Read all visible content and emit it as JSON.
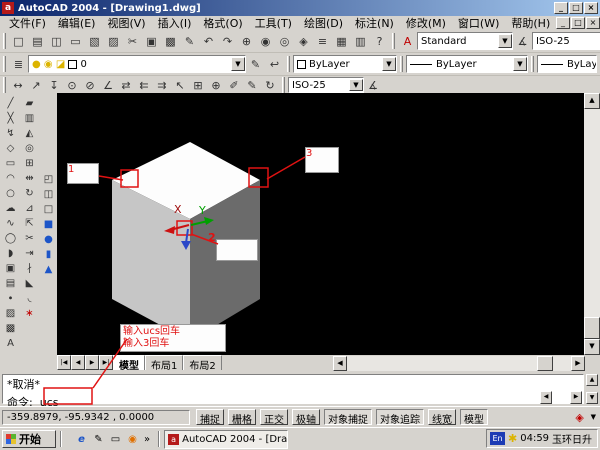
{
  "icons": {
    "dropdown": "▼"
  },
  "window": {
    "title": "AutoCAD 2004 - [Drawing1.dwg]",
    "app_icon_letter": "a",
    "controls": {
      "minimize": "_",
      "restore": "□",
      "close": "×"
    }
  },
  "menubar": {
    "items": [
      {
        "name": "menu-file",
        "label": "文件(F)"
      },
      {
        "name": "menu-edit",
        "label": "编辑(E)"
      },
      {
        "name": "menu-view",
        "label": "视图(V)"
      },
      {
        "name": "menu-insert",
        "label": "插入(I)"
      },
      {
        "name": "menu-format",
        "label": "格式(O)"
      },
      {
        "name": "menu-tools",
        "label": "工具(T)"
      },
      {
        "name": "menu-draw",
        "label": "绘图(D)"
      },
      {
        "name": "menu-dimension",
        "label": "标注(N)"
      },
      {
        "name": "menu-modify",
        "label": "修改(M)"
      },
      {
        "name": "menu-window",
        "label": "窗口(W)"
      },
      {
        "name": "menu-help",
        "label": "帮助(H)"
      }
    ]
  },
  "toolbars": {
    "standard": {
      "items": [
        {
          "name": "new-button",
          "glyph": "□"
        },
        {
          "name": "open-button",
          "glyph": "▤"
        },
        {
          "name": "save-button",
          "glyph": "◫"
        },
        {
          "name": "plot-button",
          "glyph": "▭"
        },
        {
          "name": "plot-preview-button",
          "glyph": "▧"
        },
        {
          "name": "publish-button",
          "glyph": "▨"
        },
        {
          "name": "cut-button",
          "glyph": "✂"
        },
        {
          "name": "copy-button",
          "glyph": "▣"
        },
        {
          "name": "paste-button",
          "glyph": "▩"
        },
        {
          "name": "match-properties-button",
          "glyph": "✎"
        },
        {
          "name": "undo-button",
          "glyph": "↶"
        },
        {
          "name": "redo-button",
          "glyph": "↷"
        },
        {
          "name": "pan-button",
          "glyph": "⊕"
        },
        {
          "name": "zoom-realtime-button",
          "glyph": "◉"
        },
        {
          "name": "zoom-window-button",
          "glyph": "◎"
        },
        {
          "name": "zoom-previous-button",
          "glyph": "◈"
        },
        {
          "name": "properties-button",
          "glyph": "≡"
        },
        {
          "name": "designcenter-button",
          "glyph": "▦"
        },
        {
          "name": "tool-palettes-button",
          "glyph": "▥"
        },
        {
          "name": "help-button",
          "glyph": "?"
        }
      ]
    },
    "styles": {
      "text_style_icon": "A",
      "text_style": "Standard",
      "dim_style_icon": "∡",
      "dim_style": "ISO-25"
    },
    "layers": {
      "manager_icon": "≣",
      "bulb_icon": "●",
      "freeze_icon": "◉",
      "lock_icon": "◪",
      "current_layer": "0",
      "make_current_icon": "✎",
      "layer_previous_icon": "↩"
    },
    "properties": {
      "color": "ByLayer",
      "linetype": "ByLayer",
      "lineweight": "ByLayer"
    },
    "dimension": {
      "items": [
        {
          "name": "linear-dimension-button",
          "glyph": "↔"
        },
        {
          "name": "aligned-dimension-button",
          "glyph": "↗"
        },
        {
          "name": "ordinate-dimension-button",
          "glyph": "↧"
        },
        {
          "name": "radius-dimension-button",
          "glyph": "⊙"
        },
        {
          "name": "diameter-dimension-button",
          "glyph": "⊘"
        },
        {
          "name": "angular-dimension-button",
          "glyph": "∠"
        },
        {
          "name": "quick-dimension-button",
          "glyph": "⇄"
        },
        {
          "name": "baseline-dimension-button",
          "glyph": "⇇"
        },
        {
          "name": "continue-dimension-button",
          "glyph": "⇉"
        },
        {
          "name": "quick-leader-button",
          "glyph": "↖"
        },
        {
          "name": "tolerance-button",
          "glyph": "⊞"
        },
        {
          "name": "center-mark-button",
          "glyph": "⊕"
        },
        {
          "name": "dimension-edit-button",
          "glyph": "✐"
        },
        {
          "name": "dimension-text-edit-button",
          "glyph": "✎"
        },
        {
          "name": "dimension-update-button",
          "glyph": "↻"
        }
      ],
      "dim_style": "ISO-25",
      "dim_style_icon": "∡"
    },
    "draw": {
      "items": [
        {
          "name": "line-button",
          "glyph": "╱"
        },
        {
          "name": "construction-line-button",
          "glyph": "╳"
        },
        {
          "name": "polyline-button",
          "glyph": "↯"
        },
        {
          "name": "polygon-button",
          "glyph": "◇"
        },
        {
          "name": "rectangle-button",
          "glyph": "▭"
        },
        {
          "name": "arc-button",
          "glyph": "◠"
        },
        {
          "name": "circle-button",
          "glyph": "○"
        },
        {
          "name": "revcloud-button",
          "glyph": "☁"
        },
        {
          "name": "spline-button",
          "glyph": "∿"
        },
        {
          "name": "ellipse-button",
          "glyph": "◯"
        },
        {
          "name": "ellipse-arc-button",
          "glyph": "◗"
        },
        {
          "name": "insert-block-button",
          "glyph": "▣"
        },
        {
          "name": "make-block-button",
          "glyph": "▤"
        },
        {
          "name": "point-button",
          "glyph": "∙"
        },
        {
          "name": "hatch-button",
          "glyph": "▨"
        },
        {
          "name": "region-button",
          "glyph": "▩"
        },
        {
          "name": "multiline-text-button",
          "glyph": "A"
        }
      ]
    },
    "modify": {
      "items": [
        {
          "name": "erase-button",
          "glyph": "▰"
        },
        {
          "name": "copy-object-button",
          "glyph": "▥"
        },
        {
          "name": "mirror-button",
          "glyph": "◭"
        },
        {
          "name": "offset-button",
          "glyph": "◎"
        },
        {
          "name": "array-button",
          "glyph": "⊞"
        },
        {
          "name": "move-button",
          "glyph": "⇹"
        },
        {
          "name": "rotate-button",
          "glyph": "↻"
        },
        {
          "name": "scale-button",
          "glyph": "⊿"
        },
        {
          "name": "stretch-button",
          "glyph": "⇱"
        },
        {
          "name": "trim-button",
          "glyph": "✂"
        },
        {
          "name": "extend-button",
          "glyph": "⇥"
        },
        {
          "name": "break-button",
          "glyph": "∤"
        },
        {
          "name": "chamfer-button",
          "glyph": "◣"
        },
        {
          "name": "fillet-button",
          "glyph": "◟"
        },
        {
          "name": "explode-button",
          "glyph": "∗",
          "cls": "red"
        }
      ]
    },
    "solids": {
      "items": [
        {
          "name": "text-frame-icon",
          "glyph": "◰"
        },
        {
          "name": "shapes-icon",
          "glyph": "◫"
        },
        {
          "name": "wire-box-icon",
          "glyph": "□"
        },
        {
          "name": "solid-box-icon",
          "glyph": "■",
          "cls": "blue"
        },
        {
          "name": "sphere-icon",
          "glyph": "●",
          "cls": "blue"
        },
        {
          "name": "cylinder-icon",
          "glyph": "▮",
          "cls": "blue"
        },
        {
          "name": "cone-icon",
          "glyph": "▲",
          "cls": "blue"
        }
      ]
    }
  },
  "canvas": {
    "callouts": {
      "c1": "1",
      "c2": "2",
      "c3": "3"
    },
    "instruction": {
      "line1": "输入ucs回车",
      "line2": "输入3回车"
    },
    "ucs": {
      "x_label": "X",
      "y_label": "Y"
    },
    "cube_colors": {
      "top": "#fdfdfd",
      "left": "#c6c6c6",
      "right": "#6b6b6b"
    },
    "annotation_color": "#e01212"
  },
  "layout_tabs": {
    "nav": [
      {
        "name": "tab-first-button",
        "glyph": "|◀"
      },
      {
        "name": "tab-prev-button",
        "glyph": "◀"
      },
      {
        "name": "tab-next-button",
        "glyph": "▶"
      },
      {
        "name": "tab-last-button",
        "glyph": "▶|"
      }
    ],
    "tabs": [
      {
        "name": "tab-model",
        "label": "模型",
        "active": true
      },
      {
        "name": "tab-layout1",
        "label": "布局1"
      },
      {
        "name": "tab-layout2",
        "label": "布局2"
      }
    ]
  },
  "command": {
    "history": "*取消*",
    "prompt": "命令:",
    "input": "ucs"
  },
  "statusbar": {
    "coords": "-359.8979, -95.9342 ,  0.0000",
    "toggles": [
      {
        "name": "snap-toggle",
        "label": "捕捉"
      },
      {
        "name": "grid-toggle",
        "label": "栅格"
      },
      {
        "name": "ortho-toggle",
        "label": "正交"
      },
      {
        "name": "polar-toggle",
        "label": "极轴"
      },
      {
        "name": "osnap-toggle",
        "label": "对象捕捉",
        "pressed": true
      },
      {
        "name": "otrack-toggle",
        "label": "对象追踪",
        "pressed": true
      },
      {
        "name": "lineweight-toggle",
        "label": "线宽"
      },
      {
        "name": "model-toggle",
        "label": "模型",
        "pressed": true
      }
    ],
    "comm_icon": "◈"
  },
  "taskbar": {
    "start_label": "开始",
    "quick_launch": [
      {
        "name": "ie-icon",
        "glyph": "e",
        "cls": "qlblue"
      },
      {
        "name": "paint-icon",
        "glyph": "✎"
      },
      {
        "name": "window-icon",
        "glyph": "▭"
      },
      {
        "name": "media-player-icon",
        "glyph": "◉",
        "cls": "qlorange"
      }
    ],
    "overflow_chevron": "»",
    "task_button": "AutoCAD 2004 - [Dra...",
    "task_icon_letter": "a",
    "tray": {
      "lang": "En",
      "tray_icon": "✱",
      "time": "04:59",
      "text": "玉环日升"
    }
  }
}
